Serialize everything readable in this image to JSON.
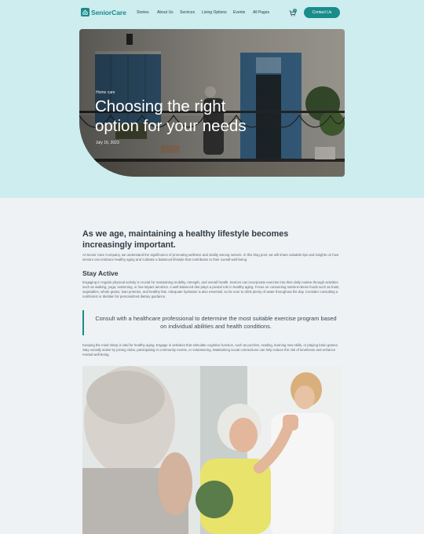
{
  "header": {
    "logo_text": "SeniorCare",
    "nav": [
      "Stories",
      "About Us",
      "Services",
      "Living Options",
      "Events",
      "All Pages"
    ],
    "cart_count": "0",
    "contact_label": "Contact Us"
  },
  "hero": {
    "breadcrumb": "Home care",
    "title": "Choosing the right option for your needs",
    "date": "July 16, 2023"
  },
  "article": {
    "heading": "As we age, maintaining a healthy lifestyle becomes increasingly important.",
    "intro": "At Senior Care Company, we understand the significance of promoting wellness and vitality among seniors. In this blog post, we will share valuable tips and insights on how seniors can embrace healthy aging and cultivate a balanced lifestyle that contributes to their overall well-being.",
    "section_title": "Stay Active",
    "section_body": "Engaging in regular physical activity is crucial for maintaining mobility, strength, and overall health. Seniors can incorporate exercise into their daily routine through activities such as walking, yoga, swimming, or low-impact aerobics. A well-balanced diet plays a pivotal role in healthy aging. Focus on consuming nutrient-dense foods such as fruits, vegetables, whole grains, lean proteins, and healthy fats. Adequate hydration is also essential, so be sure to drink plenty of water throughout the day. Consider consulting a nutritionist or dietitian for personalized dietary guidance.",
    "quote": "Consult with a healthcare professional to determine the most suitable exercise program based on individual abilities and health conditions.",
    "closing": "Keeping the mind sharp is vital for healthy aging. Engage in activities that stimulate cognitive function, such as puzzles, reading, learning new skills, or playing brain games. Stay socially active by joining clubs, participating in community events, or volunteering. Maintaining social connections can help reduce the risk of loneliness and enhance mental well-being."
  },
  "colors": {
    "brand": "#1a8c8c",
    "hero_band": "#cdedee",
    "page_bg": "#eff2f4"
  }
}
